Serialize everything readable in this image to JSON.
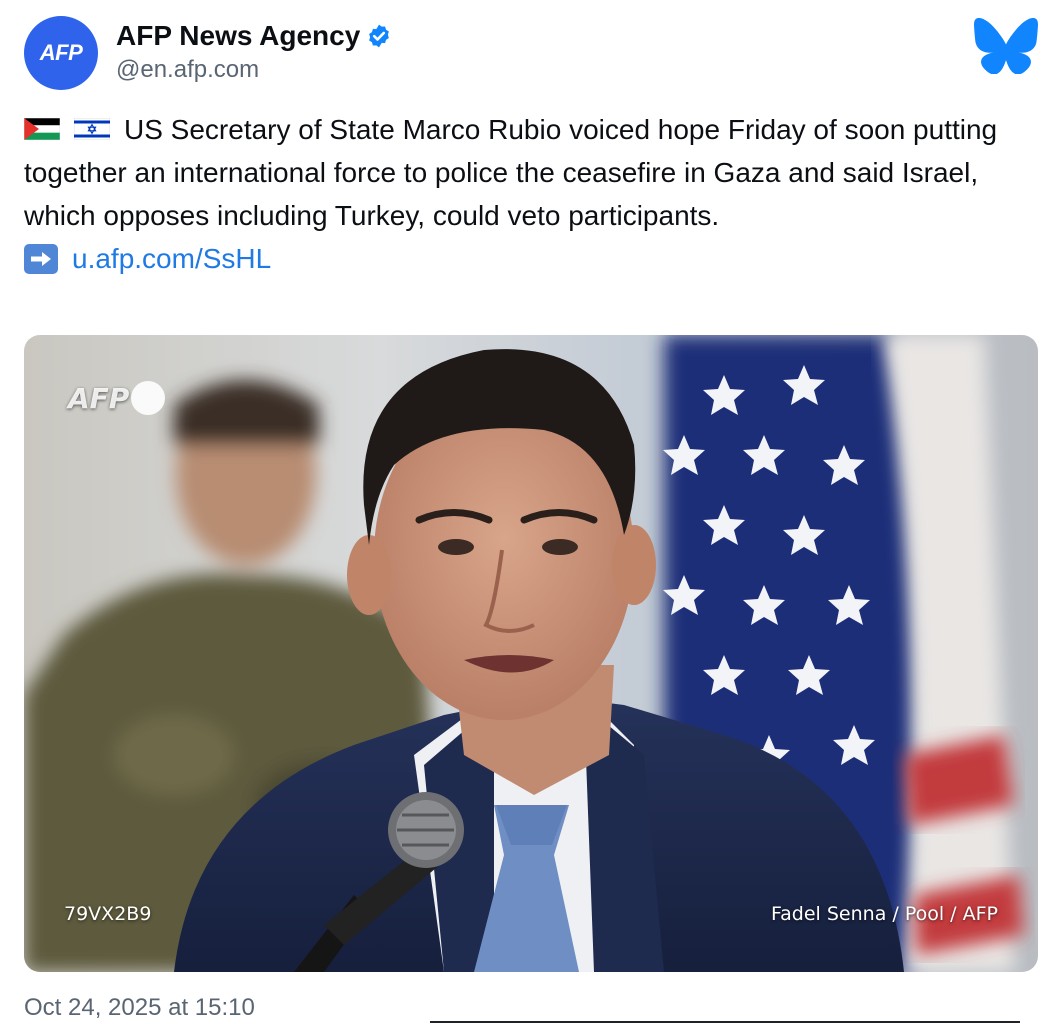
{
  "post": {
    "author": {
      "display_name": "AFP News Agency",
      "handle": "@en.afp.com",
      "avatar_text": "AFP",
      "verified": true
    },
    "flags": [
      "palestine-flag",
      "israel-flag"
    ],
    "text": "US Secretary of State Marco Rubio voiced hope Friday of soon putting together an international force to police the ceasefire in Gaza and said Israel, which opposes including Turkey, could veto participants.",
    "link_prefix_icon": "right-arrow-emoji",
    "link_text": "u.afp.com/SsHL",
    "image": {
      "watermark": "AFP",
      "code": "79VX2B9",
      "credit": "Fadel Senna / Pool / AFP"
    },
    "timestamp": "Oct 24, 2025 at 15:10"
  },
  "colors": {
    "avatar": "#2f63ec",
    "link": "#1f7ae3",
    "bluesky": "#1185fe",
    "verified": "#1185fe"
  }
}
